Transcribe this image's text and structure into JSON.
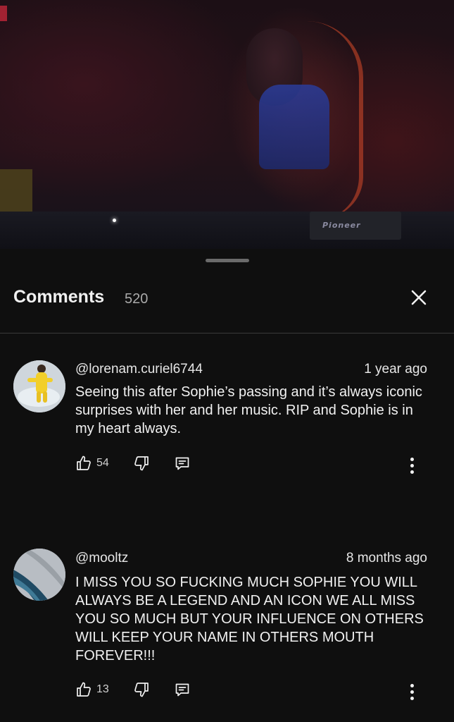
{
  "video": {
    "brand_text": "Pioneer"
  },
  "header": {
    "title": "Comments",
    "count": "520"
  },
  "comments": [
    {
      "author": "@lorenam.curiel6744",
      "time": "1 year ago",
      "text": "Seeing this after Sophie’s passing and it’s always iconic surprises with her and her music. RIP and Sophie is in my heart always.",
      "likes": "54"
    },
    {
      "author": "@mooltz",
      "time": "8 months ago",
      "text": "I MISS YOU SO FUCKING MUCH SOPHIE YOU WILL ALWAYS BE A LEGEND AND AN ICON WE ALL MISS YOU SO MUCH BUT YOUR INFLUENCE ON OTHERS WILL KEEP YOUR NAME IN OTHERS MOUTH FOREVER!!!",
      "likes": "13"
    }
  ],
  "icons": {
    "close": "close-icon",
    "like": "thumbs-up-icon",
    "dislike": "thumbs-down-icon",
    "reply": "reply-comment-icon",
    "more": "more-vertical-icon"
  }
}
